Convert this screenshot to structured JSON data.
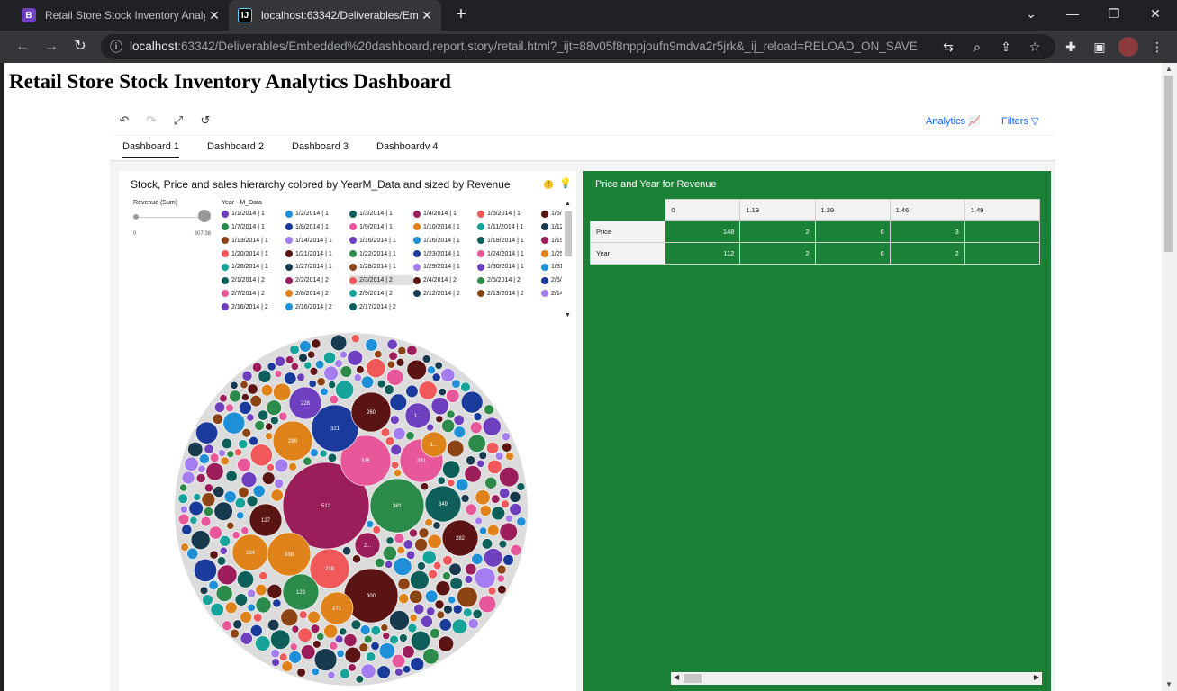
{
  "browser": {
    "tabs": [
      {
        "icon": "B",
        "title": "Retail Store Stock Inventory Analy",
        "close": "✕"
      },
      {
        "icon": "IJ",
        "title": "localhost:63342/Deliverables/Emb",
        "close": "✕"
      }
    ],
    "new_tab": "+",
    "window": {
      "minimize": "—",
      "restore": "❐",
      "close": "✕",
      "menu": "⌄"
    },
    "url_host": "localhost",
    "url_rest": ":63342/Deliverables/Embedded%20dashboard,report,story/retail.html?_ijt=88v05f8nppjoufn9mdva2r5jrk&_ij_reload=RELOAD_ON_SAVE"
  },
  "page": {
    "title": "Retail Store Stock Inventory Analytics Dashboard"
  },
  "dashboard": {
    "toolbar": {
      "analytics": "Analytics",
      "filters": "Filters"
    },
    "tabs": [
      "Dashboard 1",
      "Dashboard 2",
      "Dashboard 3",
      "Dashboardv 4"
    ],
    "active_tab": 0
  },
  "widget1": {
    "title": "Stock, Price and sales hierarchy colored by YearM_Data and sized by Revenue",
    "size_legend": {
      "label": "Revenue (Sum)",
      "min": "0",
      "max": "807.38"
    },
    "color_legend": {
      "header": "Year - M_Data",
      "items": [
        {
          "label": "1/1/2014 | 1",
          "color": "#6e3fbf"
        },
        {
          "label": "1/2/2014 | 1",
          "color": "#1f8fd8"
        },
        {
          "label": "1/3/2014 | 1",
          "color": "#0e5f5a"
        },
        {
          "label": "1/4/2014 | 1",
          "color": "#9b1d5a"
        },
        {
          "label": "1/5/2014 | 1",
          "color": "#f0585a"
        },
        {
          "label": "1/6/2014 | 1",
          "color": "#5b1414"
        },
        {
          "label": "1/7/2014 | 1",
          "color": "#2c8b4a"
        },
        {
          "label": "1/8/2014 | 1",
          "color": "#1a3a9c"
        },
        {
          "label": "1/9/2014 | 1",
          "color": "#e8579a"
        },
        {
          "label": "1/10/2014 | 1",
          "color": "#e0821a"
        },
        {
          "label": "1/11/2014 | 1",
          "color": "#16a39a"
        },
        {
          "label": "1/12/2014 | 1",
          "color": "#183a4f"
        },
        {
          "label": "1/13/2014 | 1",
          "color": "#8c4414"
        },
        {
          "label": "1/14/2014 | 1",
          "color": "#a47ef0"
        },
        {
          "label": "1/16/2014 | 1",
          "color": "#6e3fbf"
        },
        {
          "label": "1/16/2014 | 1",
          "color": "#1f8fd8"
        },
        {
          "label": "1/18/2014 | 1",
          "color": "#0e5f5a"
        },
        {
          "label": "1/19/2014 | 1",
          "color": "#9b1d5a"
        },
        {
          "label": "1/20/2014 | 1",
          "color": "#f0585a"
        },
        {
          "label": "1/21/2014 | 1",
          "color": "#5b1414"
        },
        {
          "label": "1/22/2014 | 1",
          "color": "#2c8b4a"
        },
        {
          "label": "1/23/2014 | 1",
          "color": "#1a3a9c"
        },
        {
          "label": "1/24/2014 | 1",
          "color": "#e8579a"
        },
        {
          "label": "1/25/2014 | 1",
          "color": "#e0821a"
        },
        {
          "label": "1/26/2014 | 1",
          "color": "#16a39a"
        },
        {
          "label": "1/27/2014 | 1",
          "color": "#183a4f"
        },
        {
          "label": "1/28/2014 | 1",
          "color": "#8c4414"
        },
        {
          "label": "1/29/2014 | 1",
          "color": "#a47ef0"
        },
        {
          "label": "1/30/2014 | 1",
          "color": "#6e3fbf"
        },
        {
          "label": "1/31/2014 | 1",
          "color": "#1f8fd8"
        },
        {
          "label": "2/1/2014 | 2",
          "color": "#0e5f5a"
        },
        {
          "label": "2/2/2014 | 2",
          "color": "#9b1d5a"
        },
        {
          "label": "2/3/2014 | 2",
          "color": "#f0585a",
          "highlight": true
        },
        {
          "label": "2/4/2014 | 2",
          "color": "#5b1414"
        },
        {
          "label": "2/5/2014 | 2",
          "color": "#2c8b4a"
        },
        {
          "label": "2/6/2014 | 2",
          "color": "#1a3a9c"
        },
        {
          "label": "2/7/2014 | 2",
          "color": "#e8579a"
        },
        {
          "label": "2/8/2014 | 2",
          "color": "#e0821a"
        },
        {
          "label": "2/9/2014 | 2",
          "color": "#16a39a"
        },
        {
          "label": "2/12/2014 | 2",
          "color": "#183a4f"
        },
        {
          "label": "2/13/2014 | 2",
          "color": "#8c4414"
        },
        {
          "label": "2/14/2014 | 2",
          "color": "#a47ef0"
        },
        {
          "label": "2/16/2014 | 2",
          "color": "#6e3fbf"
        },
        {
          "label": "2/16/2014 | 2",
          "color": "#1f8fd8"
        },
        {
          "label": "2/17/2014 | 2",
          "color": "#0e5f5a"
        }
      ]
    },
    "bubble_labels": [
      "512",
      "381",
      "335",
      "331",
      "321",
      "300",
      "299",
      "282",
      "260",
      "239",
      "234",
      "228",
      "127",
      "123",
      "271",
      "338",
      "349",
      "2...",
      "1...",
      "1..."
    ]
  },
  "widget2": {
    "title": "Price and Year for Revenue",
    "columns": [
      "0",
      "1.19",
      "1.29",
      "1.46",
      "1.49"
    ],
    "rows": [
      {
        "label": "Price",
        "values": [
          "148",
          "2",
          "6",
          "3",
          ""
        ]
      },
      {
        "label": "Year",
        "values": [
          "112",
          "2",
          "6",
          "2",
          ""
        ]
      }
    ]
  },
  "colors": {
    "accent_blue": "#0f62fe",
    "table_green": "#1b8137"
  }
}
